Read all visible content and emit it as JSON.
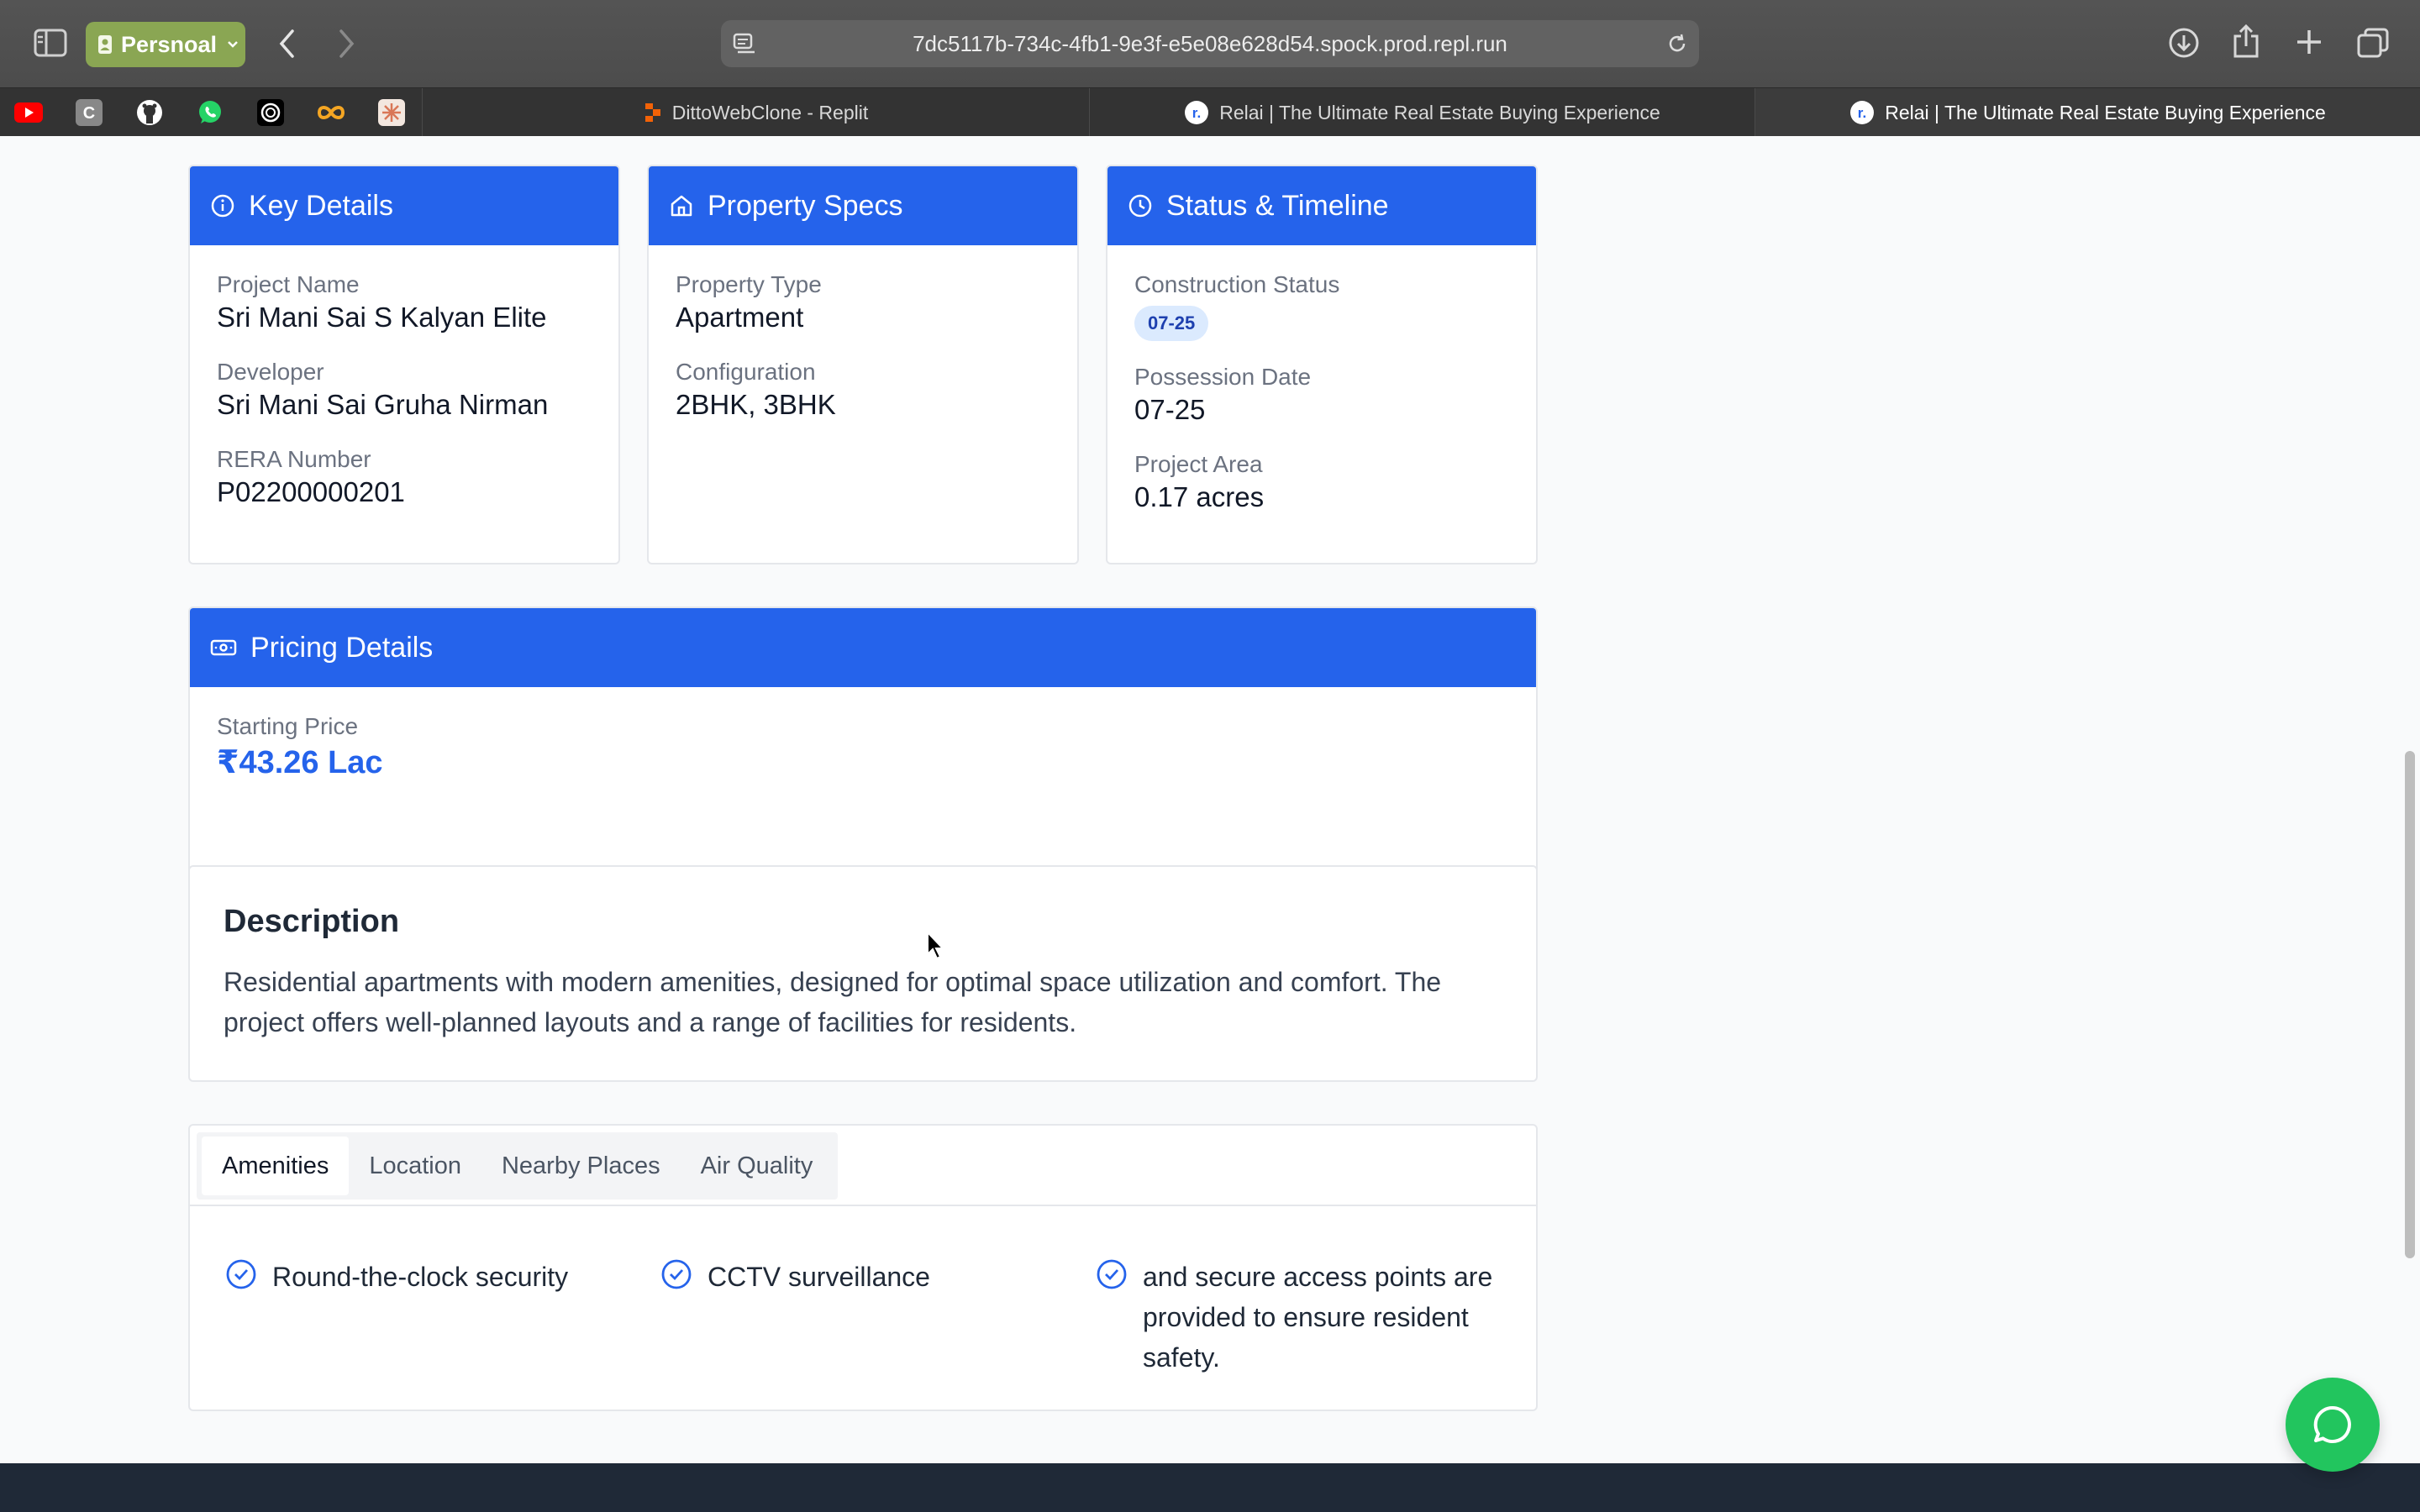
{
  "browser": {
    "profile_label": "Persnoal",
    "url": "7dc5117b-734c-4fb1-9e3f-e5e08e628d54.spock.prod.repl.run",
    "favorites": [
      {
        "name": "youtube-favicon",
        "color": "#ff0000"
      },
      {
        "name": "c-favicon",
        "letter": "C",
        "color": "#888888"
      },
      {
        "name": "github-favicon",
        "color": "#ffffff"
      },
      {
        "name": "whatsapp-favicon",
        "color": "#25d366"
      },
      {
        "name": "chatgpt-favicon",
        "color": "#ffffff"
      },
      {
        "name": "infinity-favicon",
        "color": "#f5a623"
      },
      {
        "name": "claude-favicon",
        "color": "#d97757"
      }
    ],
    "tabs": [
      {
        "label": "DittoWebClone - Replit",
        "active": false
      },
      {
        "label": "Relai | The Ultimate Real Estate Buying Experience",
        "active": false
      },
      {
        "label": "Relai | The Ultimate Real Estate Buying Experience",
        "active": true
      }
    ]
  },
  "key_details": {
    "title": "Key Details",
    "project_name_label": "Project Name",
    "project_name": "Sri Mani Sai S Kalyan Elite",
    "developer_label": "Developer",
    "developer": "Sri Mani Sai Gruha Nirman",
    "rera_label": "RERA Number",
    "rera": "P02200000201"
  },
  "property_specs": {
    "title": "Property Specs",
    "type_label": "Property Type",
    "type": "Apartment",
    "config_label": "Configuration",
    "config": "2BHK, 3BHK"
  },
  "status_timeline": {
    "title": "Status & Timeline",
    "construction_label": "Construction Status",
    "construction_badge": "07-25",
    "possession_label": "Possession Date",
    "possession": "07-25",
    "area_label": "Project Area",
    "area": "0.17 acres"
  },
  "pricing": {
    "title": "Pricing Details",
    "starting_label": "Starting Price",
    "starting_price": "₹43.26 Lac"
  },
  "description": {
    "title": "Description",
    "text": "Residential apartments with modern amenities, designed for optimal space utilization and comfort. The project offers well-planned layouts and a range of facilities for residents."
  },
  "info_tabs": {
    "tabs": [
      "Amenities",
      "Location",
      "Nearby Places",
      "Air Quality"
    ],
    "active": "Amenities",
    "amenities": [
      "Round-the-clock security",
      "CCTV surveillance",
      "and secure access points are provided to ensure resident safety."
    ]
  },
  "colors": {
    "accent": "#2563eb",
    "chat": "#22c55e"
  }
}
